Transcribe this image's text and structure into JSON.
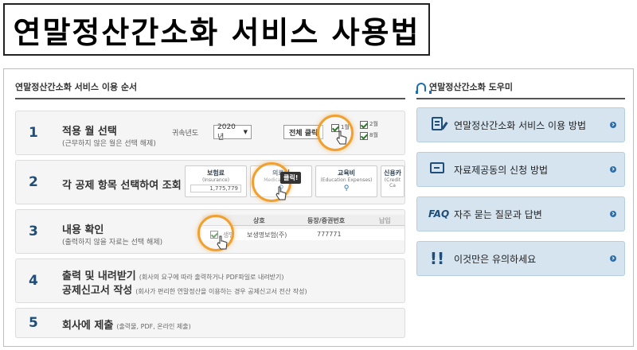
{
  "page_title": "연말정산간소화 서비스 사용법",
  "left_panel": {
    "heading": "연말정산간소화 서비스 이용 순서",
    "steps": [
      {
        "num": "1",
        "title": "적용 월 선택",
        "sub": "(근무하지 않은 월은 선택 해제)",
        "mock": {
          "year_label": "귀속년도",
          "year_value": "2020년",
          "select_all": "전체 클릭",
          "month1": "1월",
          "month2": "2월",
          "month7": "7월",
          "month8": "8월"
        }
      },
      {
        "num": "2",
        "title": "각 공제 항목 선택하여 조회",
        "sub": "",
        "mock": {
          "cards": [
            {
              "title": "보험료",
              "sub": "(Insurance)",
              "value": "1,775,779"
            },
            {
              "title": "의료비",
              "sub": "Medical Expen",
              "value": ""
            },
            {
              "title": "교육비",
              "sub": "(Education Expenses)",
              "value": ""
            },
            {
              "title": "신용카",
              "sub": "(Credit Ca",
              "value": ""
            }
          ],
          "click_label": "클릭!"
        }
      },
      {
        "num": "3",
        "title": "내용 확인",
        "sub": "(출력하지 않을 자료는 선택 해제)",
        "mock": {
          "col1": "상호",
          "col2": "등장/증권번호",
          "col3": "납입",
          "row_kind": "생명",
          "row_company": "보생명보험(주)",
          "row_number": "777771"
        }
      },
      {
        "num": "4",
        "title": "출력 및 내려받기",
        "title_note": "(회사의 요구에 따라 출력하거나 PDF파일로 내려받기)",
        "title2": "공제신고서 작성",
        "title2_note": "(회사가 편리한 연말정산을 이용하는 경우 공제신고서 전산 작성)"
      },
      {
        "num": "5",
        "title": "회사에 제출",
        "title_note": "(출력물, PDF, 온라인 제출)"
      }
    ]
  },
  "right_panel": {
    "heading": "연말정산간소화 도우미",
    "buttons": [
      {
        "label": "연말정산간소화 서비스 이용 방법",
        "icon": "document-pen-icon"
      },
      {
        "label": "자료제공동의 신청 방법",
        "icon": "file-icon"
      },
      {
        "label": "자주 묻는 질문과 답변",
        "icon_text": "FAQ"
      },
      {
        "label": "이것만은 유의하세요",
        "icon": "exclamation-icon"
      }
    ]
  },
  "colors": {
    "accent": "#1f4e79",
    "highlight_ring": "#f0a030",
    "help_button_bg": "#d6e4f0"
  }
}
